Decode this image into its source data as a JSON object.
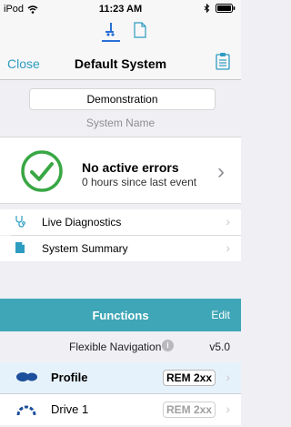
{
  "status_bar": {
    "device": "iPod",
    "time": "11:23 AM"
  },
  "nav": {
    "close_label": "Close",
    "title": "Default System"
  },
  "system": {
    "name_value": "Demonstration",
    "name_label": "System Name"
  },
  "status_card": {
    "headline": "No active errors",
    "detail": "0 hours since last event"
  },
  "menu": [
    {
      "label": "Live Diagnostics"
    },
    {
      "label": "System Summary"
    }
  ],
  "functions": {
    "title": "Functions",
    "edit_label": "Edit",
    "flexible_nav": {
      "label": "Flexible Navigation",
      "version": "v5.0"
    },
    "items": [
      {
        "label": "Profile",
        "badge": "REM 2xx"
      },
      {
        "label": "Drive 1",
        "badge": "REM 2xx"
      }
    ]
  },
  "colors": {
    "accent": "#2d9cc1",
    "header": "#3ea6b6",
    "ok_green": "#39a744",
    "selected_row": "#e6f2fb"
  }
}
